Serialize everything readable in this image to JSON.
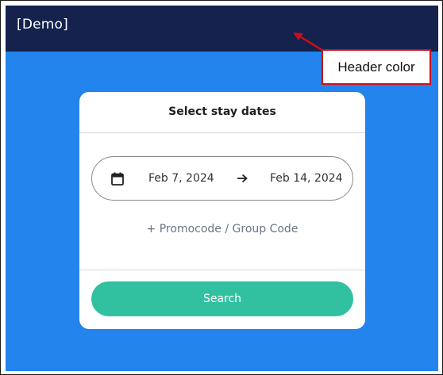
{
  "header": {
    "title": "[Demo]",
    "background_color": "#14224d"
  },
  "page": {
    "background_color": "#2284ec"
  },
  "booking_card": {
    "title": "Select stay dates",
    "date_range": {
      "start": "Feb 7, 2024",
      "end": "Feb 14, 2024",
      "start_icon": "calendar-icon",
      "separator_icon": "arrow-right-icon"
    },
    "promo_link": "+ Promocode / Group Code",
    "search_button": "Search",
    "search_button_color": "#32c1a0"
  },
  "annotation": {
    "label": "Header color",
    "border_color": "#c80e1c"
  }
}
